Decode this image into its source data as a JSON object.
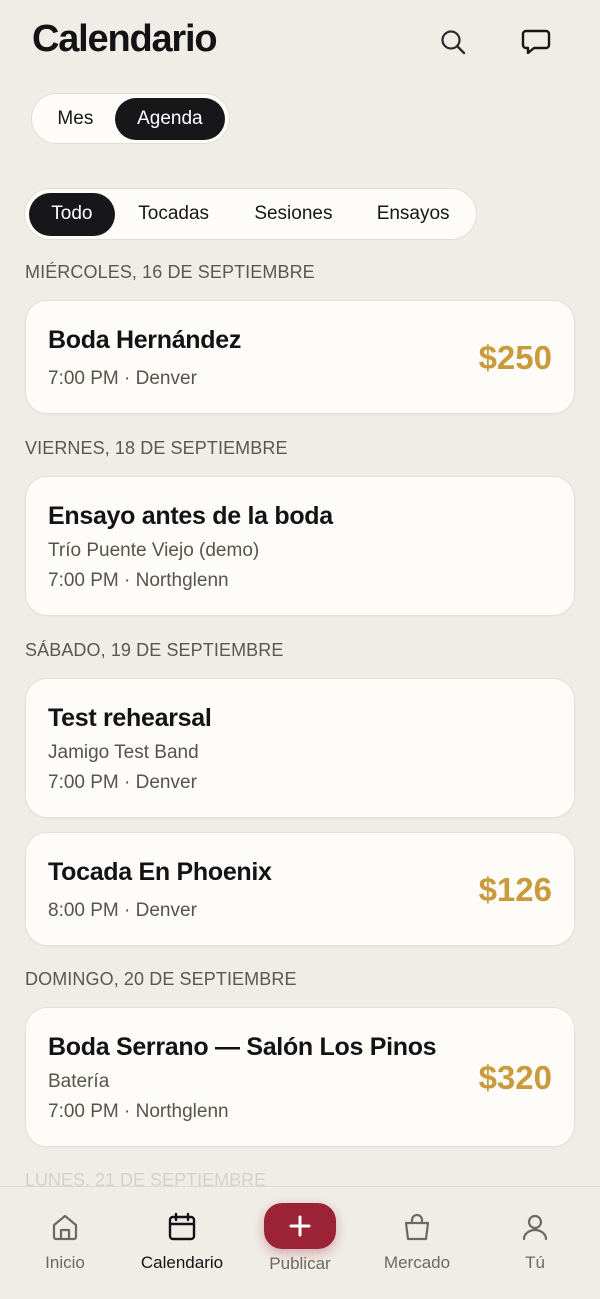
{
  "header": {
    "title": "Calendario",
    "search_icon": "search-icon",
    "chat_icon": "chat-bubble-icon"
  },
  "view_toggle": {
    "options": [
      "Mes",
      "Agenda"
    ],
    "selected": "Agenda"
  },
  "filters": {
    "chips": [
      "Todo",
      "Tocadas",
      "Sesiones",
      "Ensayos"
    ],
    "selected": "Todo"
  },
  "agenda": [
    {
      "day": "MIÉRCOLES, 16 DE SEPTIEMBRE",
      "events": [
        {
          "title": "Boda Hernández",
          "meta": "7:00 PM · Denver",
          "price": "$250"
        }
      ]
    },
    {
      "day": "VIERNES, 18 DE SEPTIEMBRE",
      "events": [
        {
          "title": "Ensayo antes de la boda",
          "subtitle": "Trío Puente Viejo (demo)",
          "meta": "7:00 PM · Northglenn"
        }
      ]
    },
    {
      "day": "SÁBADO, 19 DE SEPTIEMBRE",
      "events": [
        {
          "title": "Test rehearsal",
          "subtitle": "Jamigo Test Band",
          "meta": "7:00 PM · Denver"
        },
        {
          "title": "Tocada En Phoenix",
          "meta": "8:00 PM · Denver",
          "price": "$126"
        }
      ]
    },
    {
      "day": "DOMINGO, 20 DE SEPTIEMBRE",
      "events": [
        {
          "title": "Boda Serrano — Salón Los Pinos",
          "subtitle": "Batería",
          "meta": "7:00 PM · Northglenn",
          "price": "$320"
        }
      ]
    }
  ],
  "next_day_partial": "LUNES, 21 DE SEPTIEMBRE",
  "tabbar": {
    "items": [
      {
        "label": "Inicio",
        "icon": "home-icon"
      },
      {
        "label": "Calendario",
        "icon": "calendar-icon"
      },
      {
        "label": "Publicar",
        "icon": "plus-icon"
      },
      {
        "label": "Mercado",
        "icon": "shopping-bag-icon"
      },
      {
        "label": "Tú",
        "icon": "user-icon"
      }
    ],
    "active": "Calendario"
  },
  "colors": {
    "background": "#f0ede7",
    "card": "#fdfcf9",
    "dark": "#17171a",
    "price": "#c99b3c",
    "publish": "#9b2335"
  }
}
